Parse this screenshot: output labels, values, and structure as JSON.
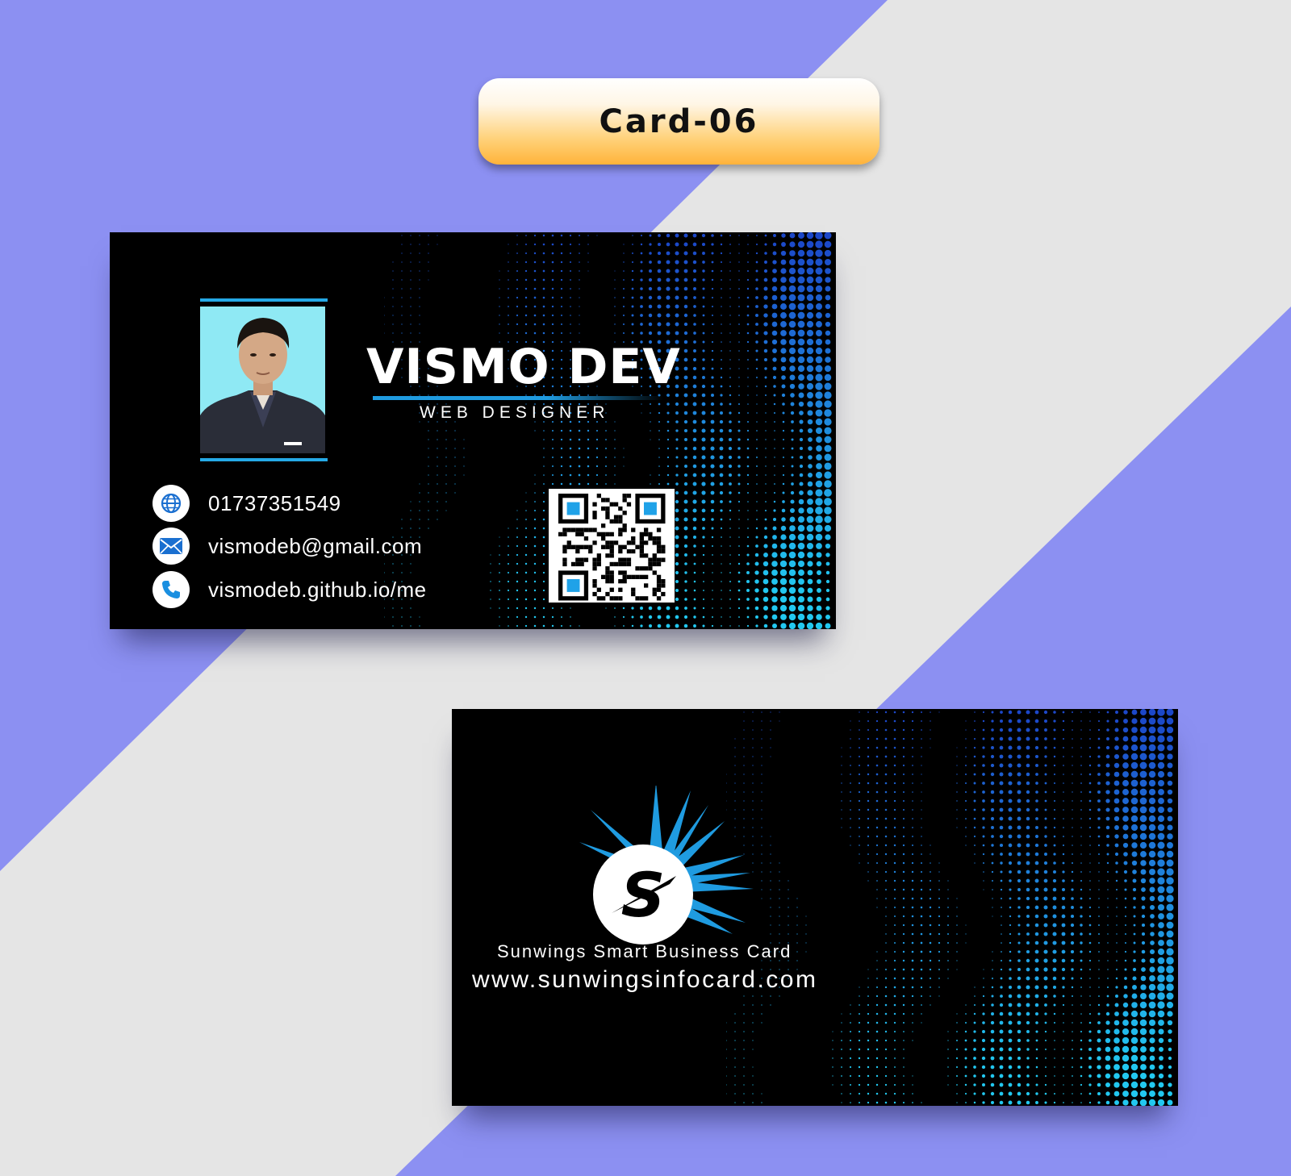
{
  "label": "Card-06",
  "front": {
    "name": "VISMO DEV",
    "title": "WEB DESIGNER",
    "contacts": [
      {
        "icon": "globe-icon",
        "text": "01737351549"
      },
      {
        "icon": "email-icon",
        "text": "vismodeb@gmail.com"
      },
      {
        "icon": "phone-icon",
        "text": "vismodeb.github.io/me"
      }
    ]
  },
  "back": {
    "brand": "Sunwings Smart Business Card",
    "url": "www.sunwingsinfocard.com"
  },
  "colors": {
    "background_purple": "#8c90f2",
    "background_grey": "#e5e5e5",
    "card": "#000000",
    "accent_blue": "#1f9be0",
    "dot_blue_dark": "#1c46c8",
    "dot_blue_light": "#22c8f0",
    "pill_orange": "#ffb33a"
  }
}
